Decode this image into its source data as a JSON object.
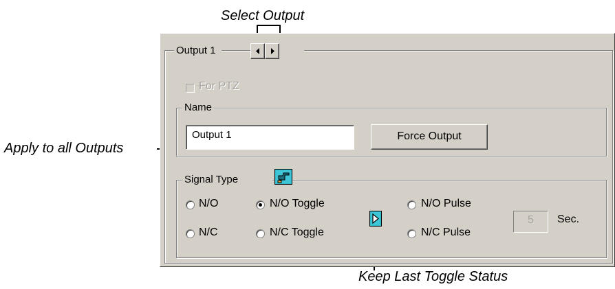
{
  "callouts": {
    "select_output": "Select Output",
    "apply_all": "Apply to all Outputs",
    "keep_toggle": "Keep Last Toggle Status"
  },
  "output_group": {
    "label": "Output 1",
    "prev_icon": "left-arrow-icon",
    "next_icon": "right-arrow-icon"
  },
  "for_ptz": {
    "label": "For PTZ",
    "checked": false,
    "enabled": false
  },
  "name_group": {
    "label": "Name",
    "value": "Output 1",
    "force_button": "Force Output"
  },
  "signal_group": {
    "label": "Signal Type",
    "apply_icon": "pointing-hand-icon",
    "options": {
      "no": "N/O",
      "no_toggle": "N/O Toggle",
      "no_pulse": "N/O Pulse",
      "nc": "N/C",
      "nc_toggle": "N/C Toggle",
      "nc_pulse": "N/C Pulse"
    },
    "selected": "N/O Toggle",
    "keep_icon": "play-arrow-icon",
    "pulse_seconds": "5",
    "seconds_unit": "Sec."
  },
  "colors": {
    "face": "#d4d0c8",
    "icon_cyan": "#2fb6c8"
  }
}
